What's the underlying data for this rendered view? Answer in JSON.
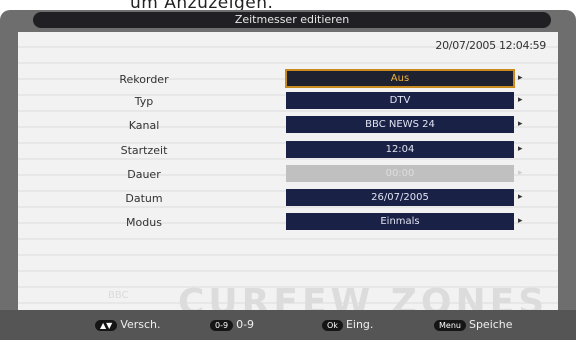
{
  "caption": "um Anzuzeigen.",
  "title": "Zeitmesser editieren",
  "datetime": "20/07/2005 12:04:59",
  "rows": [
    {
      "label": "Rekorder",
      "value": "Aus"
    },
    {
      "label": "Typ",
      "value": "DTV"
    },
    {
      "label": "Kanal",
      "value": "BBC NEWS 24"
    },
    {
      "label": "Startzeit",
      "value": "12:04"
    },
    {
      "label": "Dauer",
      "value": "00:00"
    },
    {
      "label": "Datum",
      "value": "26/07/2005"
    },
    {
      "label": "Modus",
      "value": "Einmals"
    }
  ],
  "arrow": "▸",
  "watermark": "CURFEW ZONES",
  "watermark_small": "BBC",
  "footer": {
    "move": {
      "key": "▲▼",
      "label": "Versch."
    },
    "digits": {
      "key": "0-9",
      "label": "0-9"
    },
    "ok": {
      "key": "Ok",
      "label": "Eing."
    },
    "menu": {
      "key": "Menu",
      "label": "Speiche"
    }
  }
}
